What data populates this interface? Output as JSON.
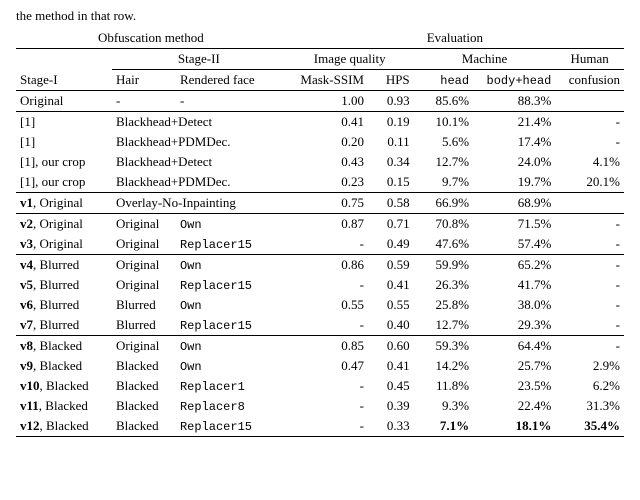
{
  "caption_fragment": "the method in that row.",
  "header": {
    "obfuscation": "Obfuscation method",
    "evaluation": "Evaluation",
    "stage2": "Stage-II",
    "image_quality": "Image quality",
    "machine": "Machine",
    "human": "Human",
    "stage1": "Stage-I",
    "hair": "Hair",
    "rendered": "Rendered face",
    "mask_ssim": "Mask-SSIM",
    "hps": "HPS",
    "head": "head",
    "bodyhead": "body+head",
    "confusion": "confusion"
  },
  "groups": [
    {
      "rows": [
        {
          "stage1": "Original",
          "hair": "-",
          "rendered": "-",
          "mask": "1.00",
          "hps": "0.93",
          "head": "85.6%",
          "bodyhead": "88.3%",
          "human": ""
        }
      ]
    },
    {
      "rows": [
        {
          "stage1": "[1]",
          "hair_rendered": "Blackhead+Detect",
          "mask": "0.41",
          "hps": "0.19",
          "head": "10.1%",
          "bodyhead": "21.4%",
          "human": "-"
        },
        {
          "stage1": "[1]",
          "hair_rendered": "Blackhead+PDMDec.",
          "mask": "0.20",
          "hps": "0.11",
          "head": "5.6%",
          "bodyhead": "17.4%",
          "human": "-"
        },
        {
          "stage1": "[1], our crop",
          "hair_rendered": "Blackhead+Detect",
          "mask": "0.43",
          "hps": "0.34",
          "head": "12.7%",
          "bodyhead": "24.0%",
          "human": "4.1%"
        },
        {
          "stage1": "[1], our crop",
          "hair_rendered": "Blackhead+PDMDec.",
          "mask": "0.23",
          "hps": "0.15",
          "head": "9.7%",
          "bodyhead": "19.7%",
          "human": "20.1%"
        }
      ]
    },
    {
      "rows": [
        {
          "stage1_v": "v1",
          "stage1_rest": ", Original",
          "hair_rendered": "Overlay-No-Inpainting",
          "mask": "0.75",
          "hps": "0.58",
          "head": "66.9%",
          "bodyhead": "68.9%",
          "human": ""
        }
      ]
    },
    {
      "rows": [
        {
          "stage1_v": "v2",
          "stage1_rest": ", Original",
          "hair": "Original",
          "rendered_tt": "Own",
          "mask": "0.87",
          "hps": "0.71",
          "head": "70.8%",
          "bodyhead": "71.5%",
          "human": "-"
        },
        {
          "stage1_v": "v3",
          "stage1_rest": ", Original",
          "hair": "Original",
          "rendered_tt": "Replacer15",
          "mask": "-",
          "hps": "0.49",
          "head": "47.6%",
          "bodyhead": "57.4%",
          "human": "-"
        }
      ]
    },
    {
      "rows": [
        {
          "stage1_v": "v4",
          "stage1_rest": ", Blurred",
          "hair": "Original",
          "rendered_tt": "Own",
          "mask": "0.86",
          "hps": "0.59",
          "head": "59.9%",
          "bodyhead": "65.2%",
          "human": "-"
        },
        {
          "stage1_v": "v5",
          "stage1_rest": ", Blurred",
          "hair": "Original",
          "rendered_tt": "Replacer15",
          "mask": "-",
          "hps": "0.41",
          "head": "26.3%",
          "bodyhead": "41.7%",
          "human": "-"
        },
        {
          "stage1_v": "v6",
          "stage1_rest": ", Blurred",
          "hair": "Blurred",
          "rendered_tt": "Own",
          "mask": "0.55",
          "hps": "0.55",
          "head": "25.8%",
          "bodyhead": "38.0%",
          "human": "-"
        },
        {
          "stage1_v": "v7",
          "stage1_rest": ", Blurred",
          "hair": "Blurred",
          "rendered_tt": "Replacer15",
          "mask": "-",
          "hps": "0.40",
          "head": "12.7%",
          "bodyhead": "29.3%",
          "human": "-"
        }
      ]
    },
    {
      "rows": [
        {
          "stage1_v": "v8",
          "stage1_rest": ", Blacked",
          "hair": "Original",
          "rendered_tt": "Own",
          "mask": "0.85",
          "hps": "0.60",
          "head": "59.3%",
          "bodyhead": "64.4%",
          "human": "-"
        },
        {
          "stage1_v": "v9",
          "stage1_rest": ", Blacked",
          "hair": "Blacked",
          "rendered_tt": "Own",
          "mask": "0.47",
          "hps": "0.41",
          "head": "14.2%",
          "bodyhead": "25.7%",
          "human": "2.9%"
        },
        {
          "stage1_v": "v10",
          "stage1_rest": ", Blacked",
          "hair": "Blacked",
          "rendered_tt": "Replacer1",
          "mask": "-",
          "hps": "0.45",
          "head": "11.8%",
          "bodyhead": "23.5%",
          "human": "6.2%"
        },
        {
          "stage1_v": "v11",
          "stage1_rest": ", Blacked",
          "hair": "Blacked",
          "rendered_tt": "Replacer8",
          "mask": "-",
          "hps": "0.39",
          "head": "9.3%",
          "bodyhead": "22.4%",
          "human": "31.3%"
        },
        {
          "stage1_v": "v12",
          "stage1_rest": ", Blacked",
          "hair": "Blacked",
          "rendered_tt": "Replacer15",
          "mask": "-",
          "hps": "0.33",
          "head_b": "7.1%",
          "bodyhead_b": "18.1%",
          "human_b": "35.4%"
        }
      ]
    }
  ]
}
